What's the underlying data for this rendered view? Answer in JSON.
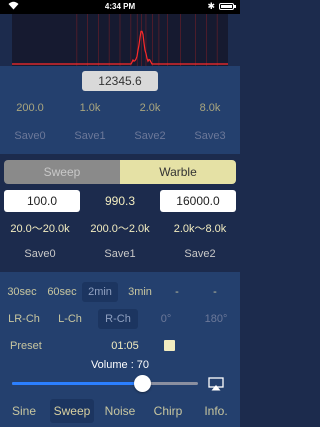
{
  "status_bar": {
    "time": "4:34 PM",
    "bluetooth": "✱"
  },
  "spectrum": {
    "peak_center_fraction": 0.6,
    "line_positions": [
      0.3,
      0.35,
      0.4,
      0.45,
      0.5,
      0.55,
      0.58,
      0.6,
      0.62,
      0.65,
      0.68,
      0.72,
      0.78,
      0.85,
      0.9,
      0.95
    ]
  },
  "freq_display": "12345.6",
  "presets": {
    "values": [
      "200.0",
      "1.0k",
      "2.0k",
      "8.0k"
    ],
    "saves": [
      "Save0",
      "Save1",
      "Save2",
      "Save3"
    ]
  },
  "mode_toggle": {
    "sweep": "Sweep",
    "warble": "Warble",
    "selected": "Warble"
  },
  "range": {
    "low": "100.0",
    "center": "990.3",
    "high": "16000.0",
    "preset_ranges": [
      "20.0〜20.0k",
      "200.0〜2.0k",
      "2.0k〜8.0k"
    ],
    "preset_saves": [
      "Save0",
      "Save1",
      "Save2"
    ]
  },
  "durations": {
    "items": [
      "30sec",
      "60sec",
      "2min",
      "3min",
      "-",
      "-"
    ],
    "selected": "2min"
  },
  "channels": {
    "items": [
      "LR-Ch",
      "L-Ch",
      "R-Ch",
      "0°",
      "180°"
    ],
    "selected": "R-Ch"
  },
  "preset_label": "Preset",
  "timer": "01:05",
  "volume_label": "Volume : 70",
  "volume_level": 0.7,
  "tabs": {
    "items": [
      "Sine",
      "Sweep",
      "Noise",
      "Chirp",
      "Info."
    ],
    "selected": "Sweep"
  },
  "colors": {
    "accent": "#2b7fff",
    "highlight": "#e5e1a5",
    "panel": "#24406e",
    "background": "#1c2b4d"
  }
}
